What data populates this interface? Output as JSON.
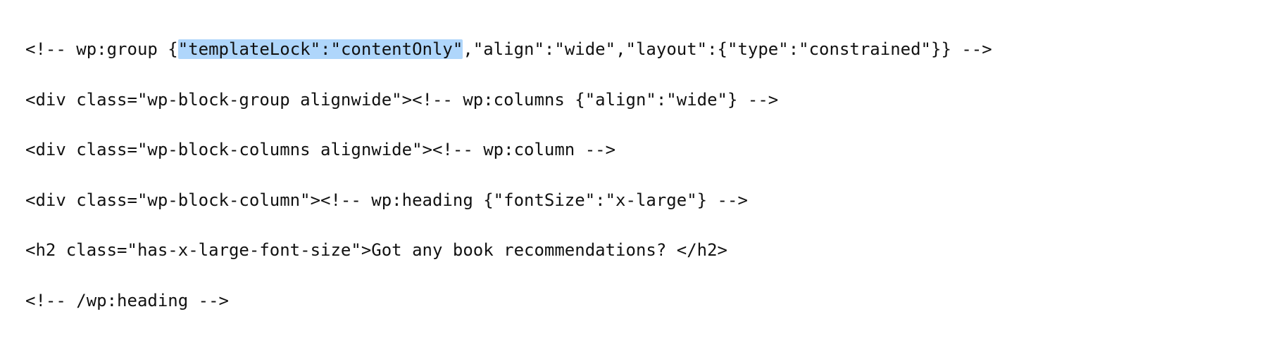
{
  "code": {
    "line1": {
      "pre": "<!-- wp:group {",
      "highlight": "\"templateLock\":\"contentOnly\"",
      "post": ",\"align\":\"wide\",\"layout\":{\"type\":\"constrained\"}} -->"
    },
    "line2": "<div class=\"wp-block-group alignwide\"><!-- wp:columns {\"align\":\"wide\"} -->",
    "line3": "<div class=\"wp-block-columns alignwide\"><!-- wp:column -->",
    "line4": "<div class=\"wp-block-column\"><!-- wp:heading {\"fontSize\":\"x-large\"} -->",
    "line5": "<h2 class=\"has-x-large-font-size\">Got any book recommendations? </h2>",
    "line6": "<!-- /wp:heading -->"
  }
}
